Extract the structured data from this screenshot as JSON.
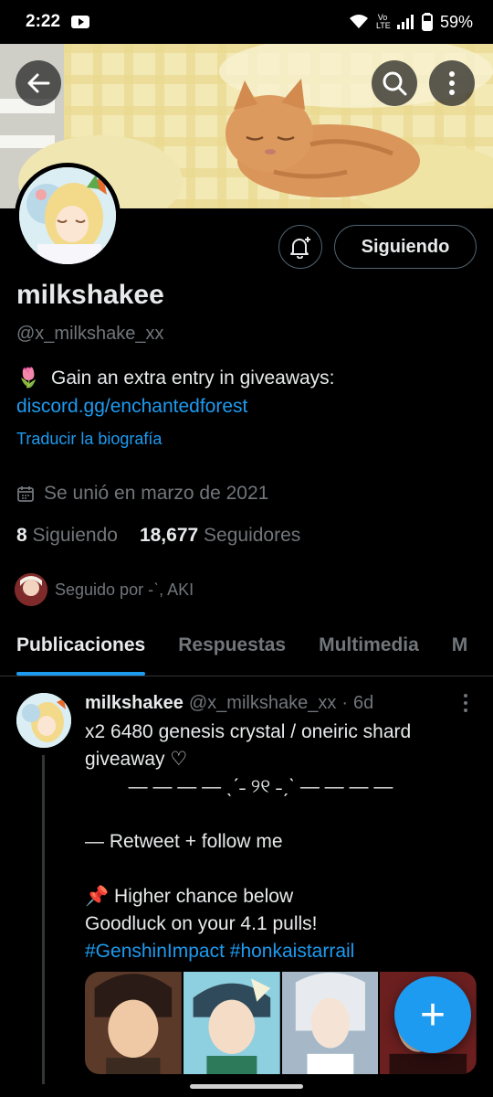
{
  "status_bar": {
    "time": "2:22",
    "battery": "59%",
    "network": "Vo LTE"
  },
  "profile": {
    "display_name": "milkshakee",
    "handle": "@x_milkshake_xx",
    "bio_emoji": "🌷",
    "bio_text": "Gain an extra entry in giveaways:",
    "bio_link": "discord.gg/enchantedforest",
    "translate_label": "Traducir la biografía",
    "joined": "Se unió en marzo de 2021",
    "following_count": "8",
    "following_label": "Siguiendo",
    "followers_count": "18,677",
    "followers_label": "Seguidores",
    "followed_by": "Seguido por -ˋ, AKI"
  },
  "actions": {
    "following_button": "Siguiendo"
  },
  "tabs": [
    {
      "label": "Publicaciones",
      "active": true
    },
    {
      "label": "Respuestas"
    },
    {
      "label": "Multimedia"
    },
    {
      "label": "M"
    }
  ],
  "tweet": {
    "name": "milkshakee",
    "handle": "@x_milkshake_xx",
    "separator": "·",
    "time": "6d",
    "line1": "x2 6480 genesis crystal / oneiric shard",
    "line2": "giveaway ♡",
    "divider": "— — — —  ˎˊ˗ ୨୧ ˗ˏˋ — — — —",
    "line4": "— Retweet + follow me",
    "line5_emoji": "📌",
    "line5": "Higher chance below",
    "line6": "Goodluck on your 4.1 pulls!",
    "hashtag1": "#GenshinImpact",
    "hashtag2": "#honkaistarrail"
  },
  "fab": {
    "label": "+"
  },
  "colors": {
    "accent": "#1d9bf0",
    "background": "#000000",
    "secondary_text": "#71767b"
  },
  "icons": [
    "back-arrow-icon",
    "search-icon",
    "more-vertical-icon",
    "bell-plus-icon",
    "calendar-icon",
    "plus-icon"
  ]
}
